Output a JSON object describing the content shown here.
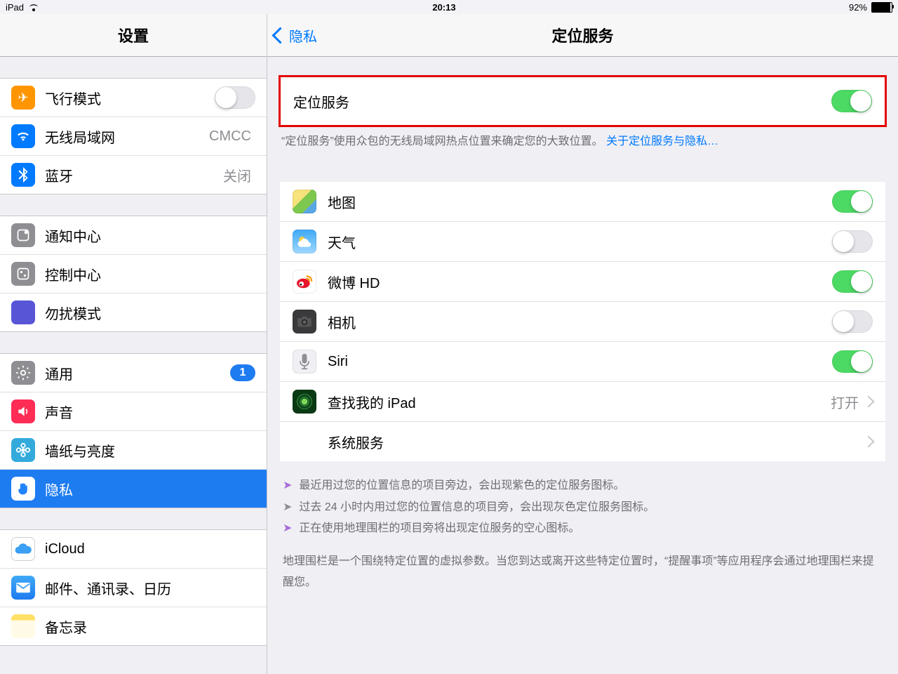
{
  "status": {
    "device": "iPad",
    "time": "20:13",
    "battery": "92%"
  },
  "sidebar": {
    "title": "设置",
    "g1": [
      {
        "label": "飞行模式",
        "detail": "",
        "toggle": "off"
      },
      {
        "label": "无线局域网",
        "detail": "CMCC"
      },
      {
        "label": "蓝牙",
        "detail": "关闭"
      }
    ],
    "g2": [
      {
        "label": "通知中心"
      },
      {
        "label": "控制中心"
      },
      {
        "label": "勿扰模式"
      }
    ],
    "g3": [
      {
        "label": "通用",
        "badge": "1"
      },
      {
        "label": "声音"
      },
      {
        "label": "墙纸与亮度"
      },
      {
        "label": "隐私",
        "selected": true
      }
    ],
    "g4": [
      {
        "label": "iCloud"
      },
      {
        "label": "邮件、通讯录、日历"
      },
      {
        "label": "备忘录"
      }
    ]
  },
  "detail": {
    "back": "隐私",
    "title": "定位服务",
    "master": {
      "label": "定位服务",
      "toggle": "on"
    },
    "master_footer_text": "“定位服务”使用众包的无线局域网热点位置来确定您的大致位置。 ",
    "master_footer_link": "关于定位服务与隐私…",
    "apps": [
      {
        "label": "地图",
        "toggle": "on",
        "icon": "maps"
      },
      {
        "label": "天气",
        "toggle": "off",
        "icon": "weather"
      },
      {
        "label": "微博 HD",
        "toggle": "on",
        "icon": "weibo"
      },
      {
        "label": "相机",
        "toggle": "off",
        "icon": "camera"
      },
      {
        "label": "Siri",
        "toggle": "on",
        "icon": "siri"
      },
      {
        "label": "查找我的 iPad",
        "detail": "打开",
        "disclosure": true,
        "icon": "find"
      },
      {
        "label": "系统服务",
        "disclosure": true
      }
    ],
    "legend": [
      "最近用过您的位置信息的项目旁边，会出现紫色的定位服务图标。",
      "过去 24 小时内用过您的位置信息的项目旁，会出现灰色定位服务图标。",
      "正在使用地理围栏的项目旁将出现定位服务的空心图标。"
    ],
    "legend_para": "地理围栏是一个围绕特定位置的虚拟参数。当您到达或离开这些特定位置时，“提醒事项”等应用程序会通过地理围栏来提醒您。"
  }
}
